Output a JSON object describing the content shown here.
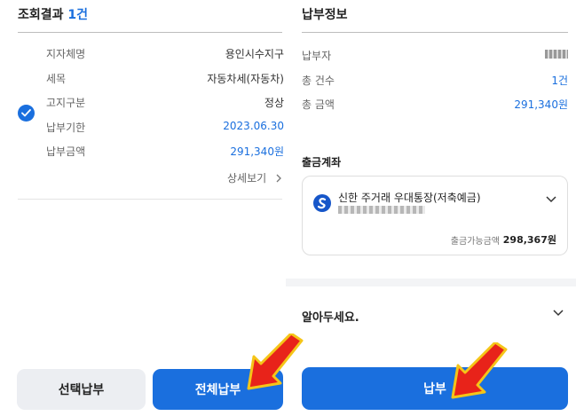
{
  "left": {
    "title_prefix": "조회결과",
    "title_count": "1건",
    "rows": [
      {
        "label": "지자체명",
        "value": "용인시수지구"
      },
      {
        "label": "세목",
        "value": "자동차세(자동차)"
      },
      {
        "label": "고지구분",
        "value": "정상"
      },
      {
        "label": "납부기한",
        "value": "2023.06.30"
      },
      {
        "label": "납부금액",
        "value": "291,340원"
      }
    ],
    "detail_link": "상세보기",
    "select_pay_button": "선택납부",
    "all_pay_button": "전체납부"
  },
  "right": {
    "title": "납부정보",
    "rows": [
      {
        "label": "납부자",
        "value": ""
      },
      {
        "label": "총 건수",
        "value": "1건"
      },
      {
        "label": "총 금액",
        "value": "291,340원"
      }
    ],
    "account_section_title": "출금계좌",
    "account_name": "신한 주거래 우대통장(저축예금)",
    "available_label": "출금가능금액",
    "available_value": "298,367원",
    "notice_title": "알아두세요.",
    "pay_button": "납부"
  },
  "colors": {
    "accent": "#1a6fde",
    "highlight_arrow": "#e8231a",
    "arrow_outline": "#f5c518"
  },
  "icons": [
    "check-icon",
    "chevron-right-icon",
    "shinhan-bank-logo",
    "chevron-down-icon",
    "red-arrow-pointer"
  ]
}
